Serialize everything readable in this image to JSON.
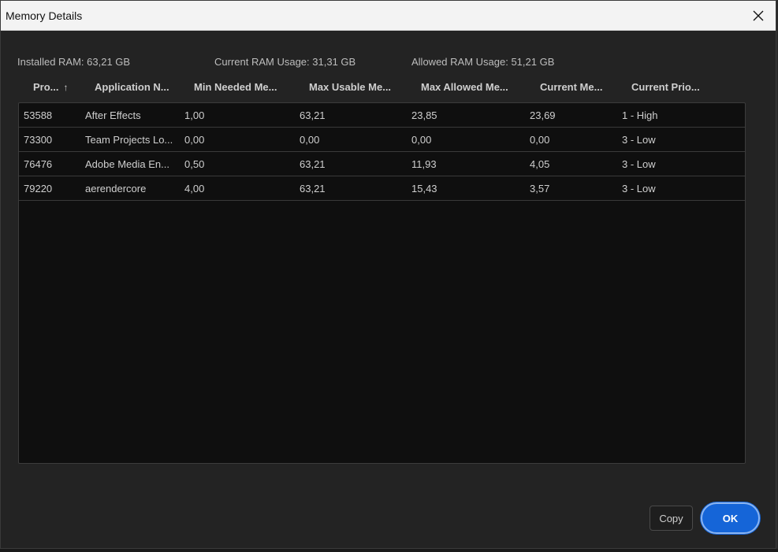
{
  "window": {
    "title": "Memory Details"
  },
  "summary": {
    "installed": "Installed RAM: 63,21 GB",
    "current": "Current RAM Usage: 31,31 GB",
    "allowed": "Allowed RAM Usage: 51,21 GB"
  },
  "table": {
    "columns": [
      "Pro...",
      "Application N...",
      "Min Needed Me...",
      "Max Usable Me...",
      "Max Allowed Me...",
      "Current Me...",
      "Current Prio..."
    ],
    "sort_indicator": "↑",
    "rows": [
      [
        "53588",
        "After Effects",
        "1,00",
        "63,21",
        "23,85",
        "23,69",
        "1 - High"
      ],
      [
        "73300",
        "Team Projects Lo...",
        "0,00",
        "0,00",
        "0,00",
        "0,00",
        "3 - Low"
      ],
      [
        "76476",
        "Adobe Media En...",
        "0,50",
        "63,21",
        "11,93",
        "4,05",
        "3 - Low"
      ],
      [
        "79220",
        "aerendercore",
        "4,00",
        "63,21",
        "15,43",
        "3,57",
        "3 - Low"
      ]
    ]
  },
  "buttons": {
    "copy": "Copy",
    "ok": "OK"
  },
  "icons": {
    "close": "close-icon",
    "sort": "arrow-up-icon"
  },
  "colors": {
    "accent": "#1565d8",
    "background": "#232323",
    "table_bg": "#0f0f0f"
  }
}
